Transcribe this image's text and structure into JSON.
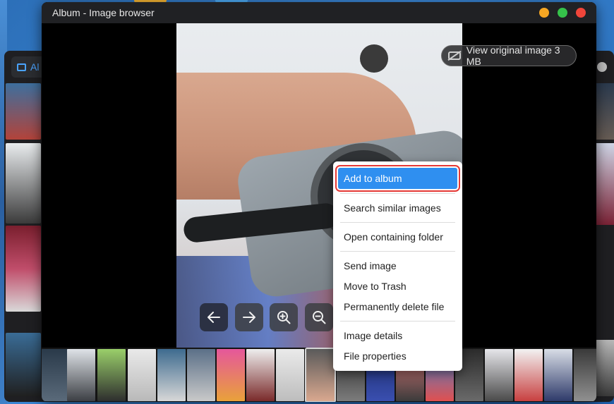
{
  "window": {
    "title": "Album - Image browser"
  },
  "back_window": {
    "tab_label": "Al"
  },
  "viewer": {
    "view_original_label": "View original image 3 MB",
    "controls": [
      {
        "name": "previous-button",
        "icon": "arrow-left-icon"
      },
      {
        "name": "next-button",
        "icon": "arrow-right-icon"
      },
      {
        "name": "zoom-in-button",
        "icon": "zoom-in-icon"
      },
      {
        "name": "zoom-out-button",
        "icon": "zoom-out-icon"
      }
    ]
  },
  "context_menu": {
    "items": [
      {
        "label": "Add to album",
        "highlighted": true
      },
      {
        "label": "Search similar images"
      },
      {
        "label": "Open containing folder"
      },
      {
        "label": "Send image"
      },
      {
        "label": "Move to Trash"
      },
      {
        "label": "Permanently delete file"
      },
      {
        "label": "Image details"
      },
      {
        "label": "File properties"
      }
    ]
  },
  "colors": {
    "accent": "#2f8ff0",
    "highlight_border": "#e53935",
    "window_close": "#f0453a",
    "window_maximize": "#35c24a",
    "window_minimize": "#f5a623"
  }
}
